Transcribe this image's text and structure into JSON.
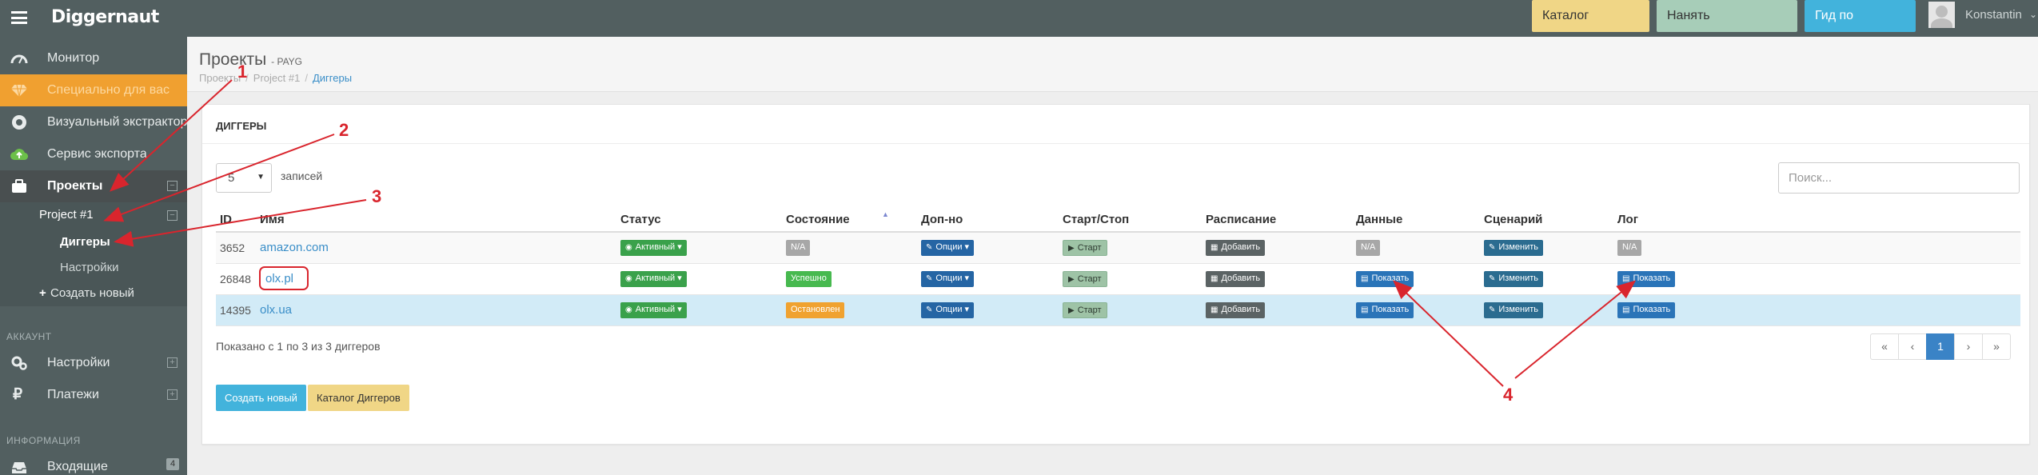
{
  "app": {
    "brand": "Diggernaut"
  },
  "topbar": {
    "catalog_label": "Каталог Диггеров",
    "hire_label": "Нанять разработчика",
    "guide_label": "Гид по странице",
    "user_name": "Konstantin"
  },
  "sidebar": {
    "items": [
      {
        "label": "Монитор",
        "icon": "dashboard-icon"
      },
      {
        "label": "Специально для вас",
        "icon": "diamond-icon"
      },
      {
        "label": "Визуальный экстрактор",
        "icon": "chrome-icon"
      },
      {
        "label": "Сервис экспорта",
        "icon": "cloud-upload-icon"
      },
      {
        "label": "Проекты",
        "icon": "briefcase-icon"
      }
    ],
    "project": "Project #1",
    "diggers": "Диггеры",
    "settings": "Настройки",
    "create_new": "Создать новый",
    "account_header": "АККАУНТ",
    "account_settings": "Настройки",
    "payments": "Платежи",
    "info_header": "ИНФОРМАЦИЯ",
    "inbox": "Входящие",
    "inbox_count": "4"
  },
  "header": {
    "title": "Проекты",
    "subtitle": "- PAYG",
    "breadcrumb": [
      "Проекты",
      "Project #1",
      "Диггеры"
    ]
  },
  "panel": {
    "title": "ДИГГЕРЫ",
    "length_value": "5",
    "length_label": "записей",
    "search_placeholder": "Поиск..."
  },
  "table": {
    "columns": [
      "ID",
      "Имя",
      "Статус",
      "Состояние",
      "Доп-но",
      "Старт/Стоп",
      "Расписание",
      "Данные",
      "Сценарий",
      "Лог"
    ],
    "rows": [
      {
        "id": "3652",
        "name": "amazon.com",
        "status": "Активный",
        "state": "N/A",
        "extra": "Опции",
        "start": "Старт",
        "schedule": "Добавить",
        "data": "N/A",
        "script": "Изменить",
        "log": "N/A"
      },
      {
        "id": "26848",
        "name": "olx.pl",
        "status": "Активный",
        "state": "Успешно",
        "extra": "Опции",
        "start": "Старт",
        "schedule": "Добавить",
        "data": "Показать",
        "script": "Изменить",
        "log": "Показать"
      },
      {
        "id": "14395",
        "name": "olx.ua",
        "status": "Активный",
        "state": "Остановлен",
        "extra": "Опции",
        "start": "Старт",
        "schedule": "Добавить",
        "data": "Показать",
        "script": "Изменить",
        "log": "Показать"
      }
    ]
  },
  "footer": {
    "info": "Показано с 1 по 3 из 3 диггеров",
    "pages": [
      "«",
      "‹",
      "1",
      "›",
      "»"
    ],
    "create_label": "Создать новый",
    "catalog_label": "Каталог Диггеров"
  },
  "annotations": [
    "1",
    "2",
    "3",
    "4"
  ],
  "colors": {
    "accent": "#f0a030",
    "annotation": "#d9252d",
    "topbar": "#525f60"
  }
}
